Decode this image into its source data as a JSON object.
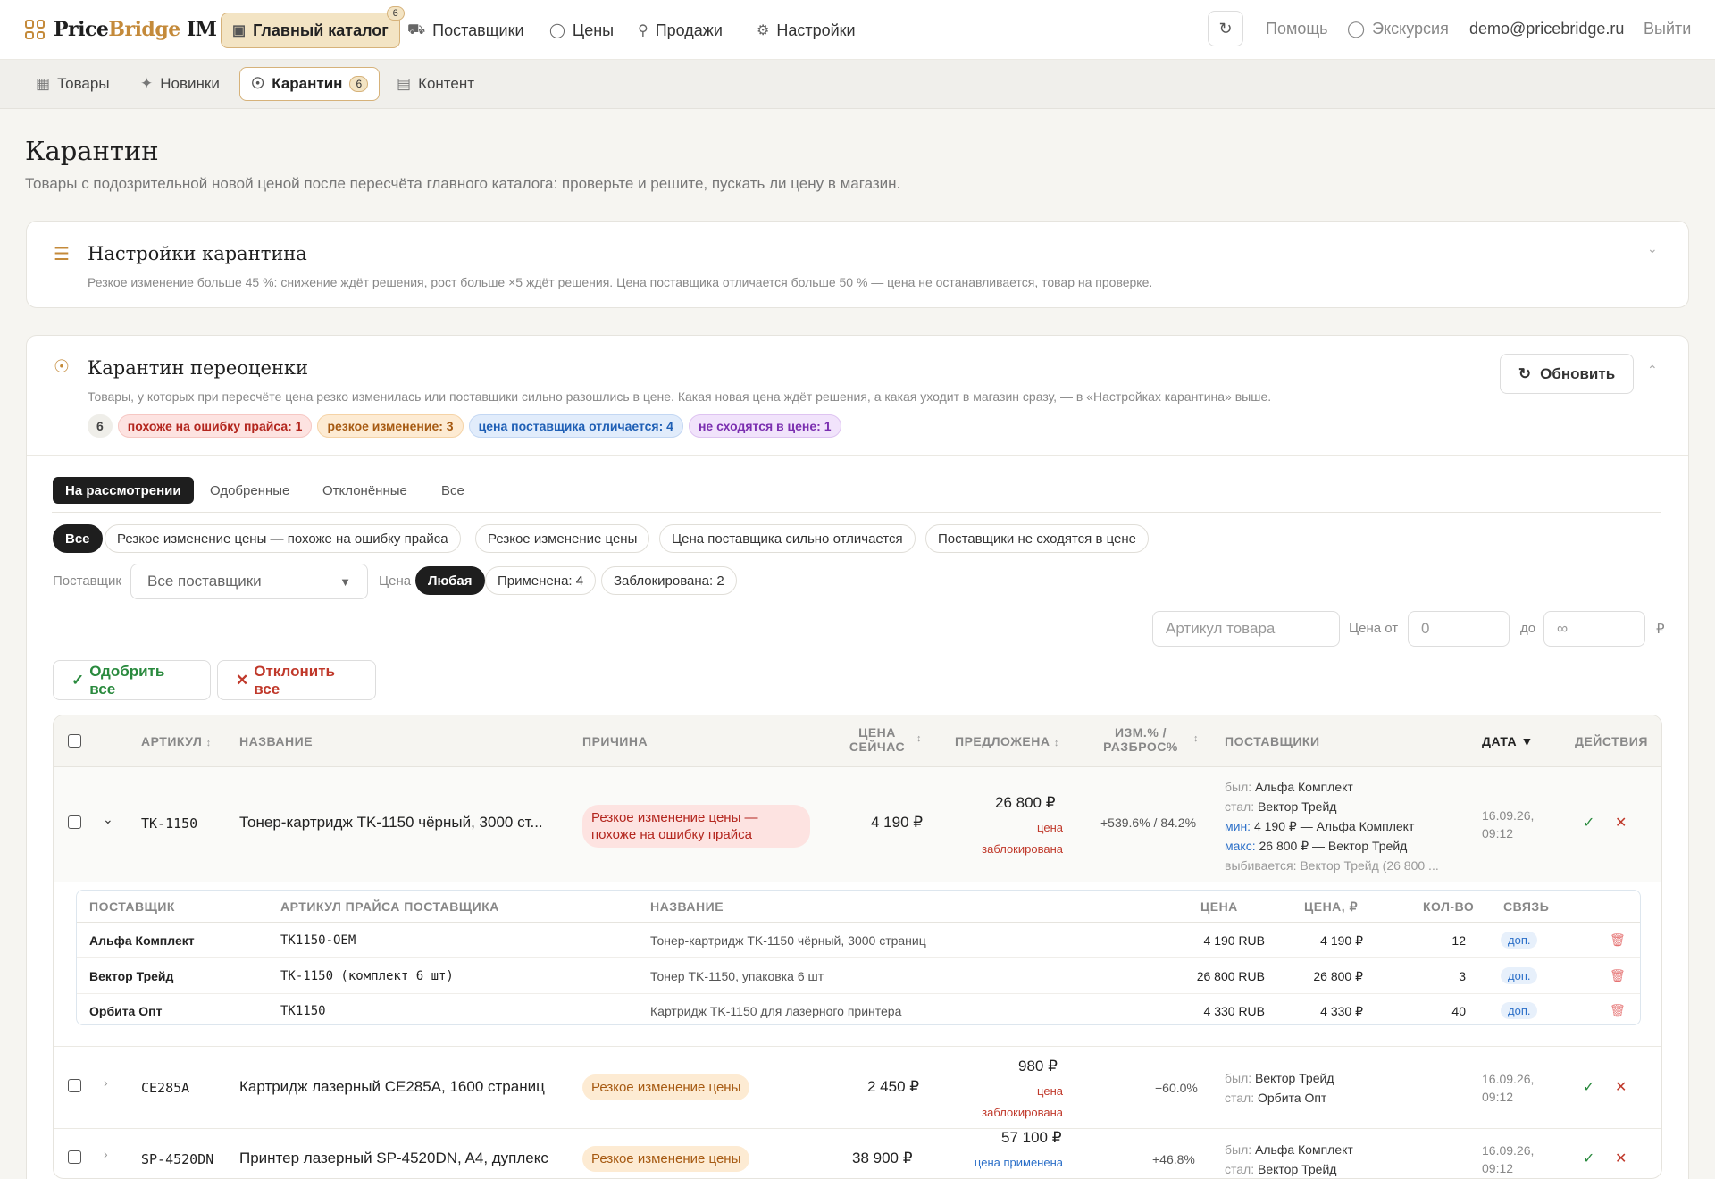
{
  "app": {
    "logo_main": "Price",
    "logo_accent": "Bridge",
    "logo_tail": " IM"
  },
  "topnav": {
    "items": [
      {
        "label": "Главный каталог",
        "badge": "6",
        "icon": "catalog-icon"
      },
      {
        "label": "Поставщики",
        "icon": "truck-icon"
      },
      {
        "label": "Цены",
        "icon": "tag-icon"
      },
      {
        "label": "Продажи",
        "icon": "cart-icon"
      },
      {
        "label": "Настройки",
        "icon": "gear-icon"
      }
    ],
    "help": "Помощь",
    "tour": "Экскурсия",
    "email": "demo@pricebridge.ru",
    "logout": "Выйти"
  },
  "subnav": {
    "items": [
      {
        "label": "Товары"
      },
      {
        "label": "Новинки"
      },
      {
        "label": "Карантин",
        "badge": "6"
      },
      {
        "label": "Контент"
      }
    ]
  },
  "page": {
    "title": "Карантин",
    "subtitle": "Товары с подозрительной новой ценой после пересчёта главного каталога: проверьте и решите, пускать ли цену в магазин."
  },
  "settings_card": {
    "title": "Настройки карантина",
    "desc": "Резкое изменение больше 45 %: снижение ждёт решения, рост больше ×5 ждёт решения. Цена поставщика отличается больше 50 % — цена не останавливается, товар на проверке."
  },
  "quarantine_card": {
    "title": "Карантин переоценки",
    "desc": "Товары, у которых при пересчёте цена резко изменилась или поставщики сильно разошлись в цене. Какая новая цена ждёт решения, а какая уходит в магазин сразу, — в «Настройках карантина» выше.",
    "refresh": "Обновить",
    "pills": {
      "total": "6",
      "error": "похоже на ошибку прайса: 1",
      "sharp": "резкое изменение: 3",
      "supplier": "цена поставщика отличается: 4",
      "mismatch": "не сходятся в цене: 1"
    },
    "colors": {
      "error_bg": "#fde3e1",
      "error_fg": "#b3261e",
      "sharp_bg": "#fdebd3",
      "sharp_fg": "#a65a12",
      "supplier_bg": "#e1ecfb",
      "supplier_fg": "#1f5fb5",
      "mismatch_bg": "#f1e3fb",
      "mismatch_fg": "#7b2fb0"
    }
  },
  "tabs": [
    "На рассмотрении",
    "Одобренные",
    "Отклонённые",
    "Все"
  ],
  "reason_filters": [
    "Все",
    "Резкое изменение цены — похоже на ошибку прайса",
    "Резкое изменение цены",
    "Цена поставщика сильно отличается",
    "Поставщики не сходятся в цене"
  ],
  "filters": {
    "supplier_label": "Поставщик",
    "supplier_value": "Все поставщики",
    "price_label": "Цена",
    "price_chips": [
      "Любая",
      "Применена: 4",
      "Заблокирована: 2"
    ],
    "sku_placeholder": "Артикул товара",
    "price_from_label": "Цена от",
    "price_from_placeholder": "0",
    "price_to_label": "до",
    "price_to_placeholder": "∞",
    "currency": "₽"
  },
  "bulk": {
    "approve": "Одобрить все",
    "reject": "Отклонить все"
  },
  "table": {
    "headers": {
      "sku": "АРТИКУЛ",
      "name": "НАЗВАНИЕ",
      "reason": "ПРИЧИНА",
      "price_now_1": "ЦЕНА",
      "price_now_2": "СЕЙЧАС",
      "proposed": "ПРЕДЛОЖЕНА",
      "change_1": "ИЗМ.% /",
      "change_2": "РАЗБРОС%",
      "suppliers": "ПОСТАВЩИКИ",
      "date": "ДАТА ▼",
      "actions": "ДЕЙСТВИЯ"
    },
    "rows": [
      {
        "sku": "TK-1150",
        "name": "Тонер-картридж TK-1150 чёрный, 3000 ст...",
        "reason": "Резкое изменение цены — похоже на ошибку прайса",
        "price_now": "4 190 ₽",
        "proposed": "26 800 ₽",
        "proposed_status_1": "цена",
        "proposed_status_2": "заблокирована",
        "change": "+539.6% / 84.2%",
        "sup_was_label": "был:",
        "sup_was": "Альфа Комплект",
        "sup_now_label": "стал:",
        "sup_now": "Вектор Трейд",
        "sup_min_label": "мин:",
        "sup_min": "4 190 ₽ — Альфа Комплект",
        "sup_max_label": "макс:",
        "sup_max": "26 800 ₽ — Вектор Трейд",
        "sup_out_label": "выбивается:",
        "sup_out": "Вектор Трейд (26 800 ...",
        "date_1": "16.09.26,",
        "date_2": "09:12"
      },
      {
        "sku": "CE285A",
        "name": "Картридж лазерный CE285A, 1600 страниц",
        "reason": "Резкое изменение цены",
        "price_now": "2 450 ₽",
        "proposed": "980 ₽",
        "proposed_status_1": "цена",
        "proposed_status_2": "заблокирована",
        "change": "−60.0%",
        "sup_was_label": "был:",
        "sup_was": "Вектор Трейд",
        "sup_now_label": "стал:",
        "sup_now": "Орбита Опт",
        "date_1": "16.09.26,",
        "date_2": "09:12"
      },
      {
        "sku": "SP-4520DN",
        "name": "Принтер лазерный SP-4520DN, A4, дуплекс",
        "reason": "Резкое изменение цены",
        "price_now": "38 900 ₽",
        "proposed": "57 100 ₽",
        "proposed_status_1": "цена применена",
        "change": "+46.8%",
        "sup_was_label": "был:",
        "sup_was": "Альфа Комплект",
        "sup_now_label": "стал:",
        "sup_now": "Вектор Трейд",
        "date_1": "16.09.26,",
        "date_2": "09:12"
      }
    ],
    "subtable": {
      "headers": {
        "supplier": "ПОСТАВЩИК",
        "supplier_sku": "АРТИКУЛ ПРАЙСА ПОСТАВЩИКА",
        "name": "НАЗВАНИЕ",
        "price": "ЦЕНА",
        "price_rub": "ЦЕНА, ₽",
        "qty": "КОЛ-ВО",
        "link": "СВЯЗЬ"
      },
      "rows": [
        {
          "supplier": "Альфа Комплект",
          "sku": "TK1150-OEM",
          "name": "Тонер-картридж TK-1150 чёрный, 3000 страниц",
          "price": "4 190 RUB",
          "price_rub": "4 190 ₽",
          "qty": "12",
          "link": "доп."
        },
        {
          "supplier": "Вектор Трейд",
          "sku": "TK-1150 (комплект 6 шт)",
          "name": "Тонер TK-1150, упаковка 6 шт",
          "price": "26 800 RUB",
          "price_rub": "26 800 ₽",
          "qty": "3",
          "link": "доп."
        },
        {
          "supplier": "Орбита Опт",
          "sku": "TK1150",
          "name": "Картридж TK-1150 для лазерного принтера",
          "price": "4 330 RUB",
          "price_rub": "4 330 ₽",
          "qty": "40",
          "link": "доп."
        }
      ]
    }
  }
}
